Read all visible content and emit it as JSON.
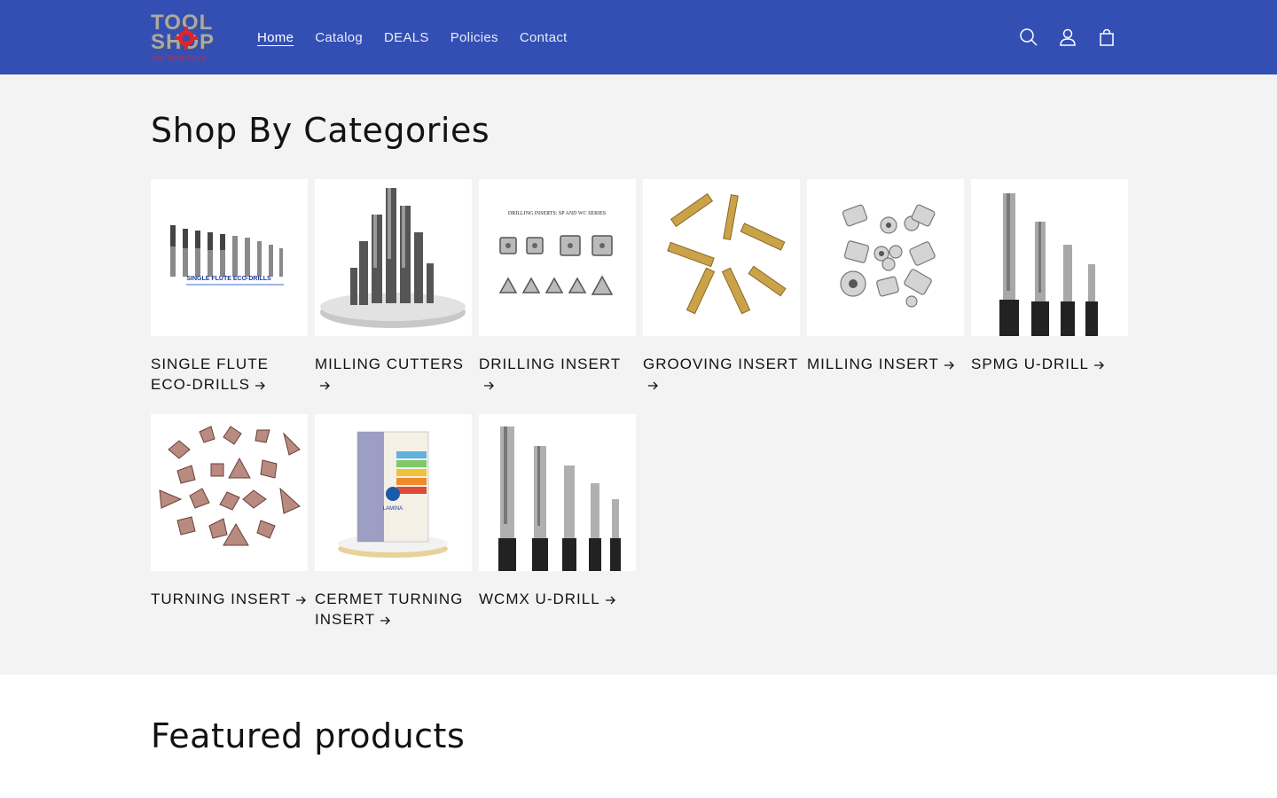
{
  "header": {
    "logo": {
      "line1": "TOOL",
      "line2": "SHOP",
      "tagline": "Your trusted shop"
    },
    "nav": [
      {
        "label": "Home",
        "active": true
      },
      {
        "label": "Catalog"
      },
      {
        "label": "DEALS"
      },
      {
        "label": "Policies"
      },
      {
        "label": "Contact"
      }
    ],
    "icons": [
      "search-icon",
      "account-icon",
      "cart-icon"
    ]
  },
  "categories": {
    "title": "Shop By Categories",
    "items": [
      {
        "label": "SINGLE FLUTE ECO-DRILLS",
        "image_caption": "SINGLE FLUTE ECO-DRILLS"
      },
      {
        "label": "MILLING CUTTERS"
      },
      {
        "label": "DRILLING INSERT",
        "image_caption": "DRILLING INSERTS: SP AND WC SERIES"
      },
      {
        "label": "GROOVING INSERT"
      },
      {
        "label": "MILLING INSERT"
      },
      {
        "label": "SPMG U-DRILL"
      },
      {
        "label": "TURNING INSERT"
      },
      {
        "label": "CERMET TURNING INSERT",
        "image_caption": "LAMINA"
      },
      {
        "label": "WCMX U-DRILL"
      }
    ]
  },
  "featured": {
    "title": "Featured products"
  },
  "colors": {
    "header_bg": "#334fb4",
    "section_bg": "#f3f3f3",
    "text": "#121212"
  }
}
